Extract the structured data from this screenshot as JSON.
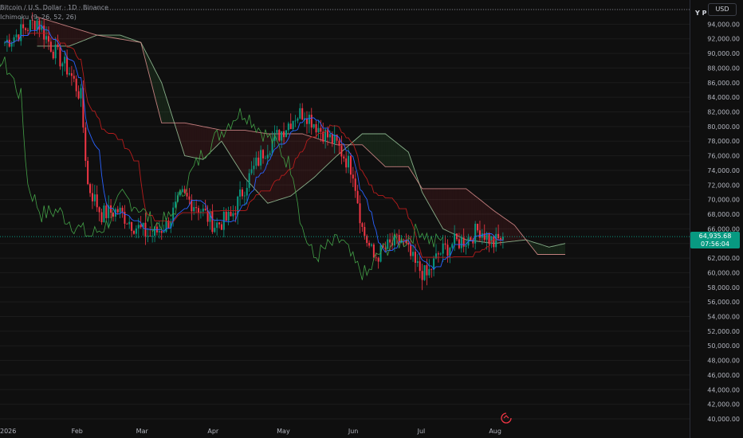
{
  "header": {
    "title": "Bitcoin / U.S. Dollar · 1D · Binance",
    "indicator": "Ichimoku (9, 26, 52, 26)",
    "currency": "USD",
    "corner_label": "Y P"
  },
  "price_tag": {
    "price": "64,935.68",
    "countdown": "07:56:04"
  },
  "colors": {
    "background": "#0f0f0f",
    "up": "#089981",
    "down": "#f23645",
    "conversion": "#2962ff",
    "base": "#b71c1c",
    "lagging": "#43a047",
    "lead_a": "#a5d6a7",
    "lead_b": "#ef9a9a",
    "grid": "#1c1c1c"
  },
  "chart_data": {
    "type": "candlestick",
    "ylim": [
      40000,
      96000
    ],
    "y_ticks": [
      "94,000.00",
      "92,000.00",
      "90,000.00",
      "88,000.00",
      "86,000.00",
      "84,000.00",
      "82,000.00",
      "80,000.00",
      "78,000.00",
      "76,000.00",
      "74,000.00",
      "72,000.00",
      "70,000.00",
      "68,000.00",
      "66,000.00",
      "62,000.00",
      "60,000.00",
      "58,000.00",
      "56,000.00",
      "54,000.00",
      "52,000.00",
      "50,000.00",
      "48,000.00",
      "46,000.00",
      "44,000.00",
      "42,000.00",
      "40,000.00"
    ],
    "x_labels": [
      "2026",
      "Feb",
      "Mar",
      "Apr",
      "May",
      "Jun",
      "Jul",
      "Aug"
    ],
    "last_price": 64935.68,
    "close_path": [
      {
        "d": "Jan 01",
        "c": 91500
      },
      {
        "d": "Jan 08",
        "c": 93000
      },
      {
        "d": "Jan 15",
        "c": 94500
      },
      {
        "d": "Jan 22",
        "c": 90500
      },
      {
        "d": "Jan 29",
        "c": 87500
      },
      {
        "d": "Feb 03",
        "c": 84000
      },
      {
        "d": "Feb 06",
        "c": 72000
      },
      {
        "d": "Feb 12",
        "c": 68000
      },
      {
        "d": "Feb 19",
        "c": 68500
      },
      {
        "d": "Feb 26",
        "c": 66500
      },
      {
        "d": "Mar 05",
        "c": 65000
      },
      {
        "d": "Mar 12",
        "c": 66500
      },
      {
        "d": "Mar 19",
        "c": 70500
      },
      {
        "d": "Mar 26",
        "c": 69000
      },
      {
        "d": "Apr 02",
        "c": 66500
      },
      {
        "d": "Apr 09",
        "c": 67500
      },
      {
        "d": "Apr 16",
        "c": 72500
      },
      {
        "d": "Apr 23",
        "c": 76500
      },
      {
        "d": "Apr 30",
        "c": 79000
      },
      {
        "d": "May 07",
        "c": 81500
      },
      {
        "d": "May 11",
        "c": 82000
      },
      {
        "d": "May 18",
        "c": 79500
      },
      {
        "d": "May 25",
        "c": 77500
      },
      {
        "d": "Jun 01",
        "c": 74000
      },
      {
        "d": "Jun 05",
        "c": 66000
      },
      {
        "d": "Jun 10",
        "c": 62000
      },
      {
        "d": "Jun 16",
        "c": 63500
      },
      {
        "d": "Jun 22",
        "c": 64500
      },
      {
        "d": "Jun 28",
        "c": 61000
      },
      {
        "d": "Jul 03",
        "c": 59500
      },
      {
        "d": "Jul 08",
        "c": 62500
      },
      {
        "d": "Jul 14",
        "c": 64000
      },
      {
        "d": "Jul 20",
        "c": 64500
      },
      {
        "d": "Jul 26",
        "c": 66000
      },
      {
        "d": "Aug 01",
        "c": 64000
      },
      {
        "d": "Aug 05",
        "c": 64935.68
      }
    ],
    "ichimoku": {
      "params": [
        9,
        26,
        52,
        26
      ],
      "span_a": [
        {
          "d": "Jan 15",
          "v": 91000
        },
        {
          "d": "Jan 29",
          "v": 91000
        },
        {
          "d": "Feb 10",
          "v": 92500
        },
        {
          "d": "Feb 20",
          "v": 92500
        },
        {
          "d": "Mar 01",
          "v": 91500
        },
        {
          "d": "Mar 10",
          "v": 86000
        },
        {
          "d": "Mar 20",
          "v": 76000
        },
        {
          "d": "Mar 28",
          "v": 75500
        },
        {
          "d": "Apr 05",
          "v": 78000
        },
        {
          "d": "Apr 15",
          "v": 73000
        },
        {
          "d": "Apr 25",
          "v": 69500
        },
        {
          "d": "May 05",
          "v": 70500
        },
        {
          "d": "May 15",
          "v": 73000
        },
        {
          "d": "May 25",
          "v": 76000
        },
        {
          "d": "Jun 05",
          "v": 79000
        },
        {
          "d": "Jun 15",
          "v": 79000
        },
        {
          "d": "Jun 25",
          "v": 76500
        },
        {
          "d": "Jul 01",
          "v": 71000
        },
        {
          "d": "Jul 10",
          "v": 66000
        },
        {
          "d": "Jul 20",
          "v": 64500
        },
        {
          "d": "Aug 01",
          "v": 64000
        },
        {
          "d": "Aug 15",
          "v": 64500
        },
        {
          "d": "Aug 25",
          "v": 63500
        },
        {
          "d": "Sep 01",
          "v": 64000
        }
      ],
      "span_b": [
        {
          "d": "Jan 15",
          "v": 95000
        },
        {
          "d": "Feb 10",
          "v": 92500
        },
        {
          "d": "Mar 01",
          "v": 91500
        },
        {
          "d": "Mar 10",
          "v": 80500
        },
        {
          "d": "Mar 20",
          "v": 80500
        },
        {
          "d": "Apr 05",
          "v": 79500
        },
        {
          "d": "Apr 15",
          "v": 79500
        },
        {
          "d": "Apr 25",
          "v": 79000
        },
        {
          "d": "May 10",
          "v": 79000
        },
        {
          "d": "May 25",
          "v": 77500
        },
        {
          "d": "Jun 05",
          "v": 77500
        },
        {
          "d": "Jun 15",
          "v": 74500
        },
        {
          "d": "Jun 25",
          "v": 74500
        },
        {
          "d": "Jul 01",
          "v": 71500
        },
        {
          "d": "Jul 20",
          "v": 71500
        },
        {
          "d": "Aug 01",
          "v": 68500
        },
        {
          "d": "Aug 10",
          "v": 66500
        },
        {
          "d": "Aug 20",
          "v": 62500
        },
        {
          "d": "Sep 01",
          "v": 62500
        }
      ]
    }
  }
}
